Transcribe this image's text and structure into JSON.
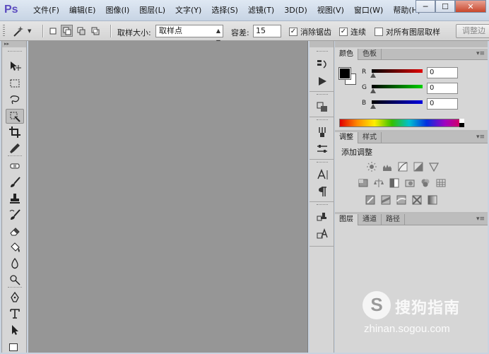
{
  "app": {
    "logo": "Ps"
  },
  "menu": [
    "文件(F)",
    "编辑(E)",
    "图像(I)",
    "图层(L)",
    "文字(Y)",
    "选择(S)",
    "滤镜(T)",
    "3D(D)",
    "视图(V)",
    "窗口(W)",
    "帮助(H)"
  ],
  "window_controls": {
    "minimize": "─",
    "maximize": "☐",
    "close": "✕"
  },
  "options": {
    "sample_size_label": "取样大小:",
    "sample_size_value": "取样点",
    "tolerance_label": "容差:",
    "tolerance_value": "15",
    "antialias_label": "消除锯齿",
    "antialias_checked": true,
    "contiguous_label": "连续",
    "contiguous_checked": true,
    "sample_all_label": "对所有图层取样",
    "sample_all_checked": false,
    "refine_edge_label": "调整边"
  },
  "panels": {
    "color_tabs": [
      "颜色",
      "色板"
    ],
    "channels": [
      {
        "label": "R",
        "value": "0"
      },
      {
        "label": "G",
        "value": "0"
      },
      {
        "label": "B",
        "value": "0"
      }
    ],
    "foreground_color": "#000000",
    "background_color": "#ffffff",
    "adjust_tabs": [
      "调整",
      "样式"
    ],
    "add_adjustment_label": "添加调整",
    "layer_tabs": [
      "图层",
      "通道",
      "路径"
    ]
  },
  "watermark": {
    "logo": "S",
    "text": "搜狗指南",
    "url": "zhinan.sogou.com"
  }
}
